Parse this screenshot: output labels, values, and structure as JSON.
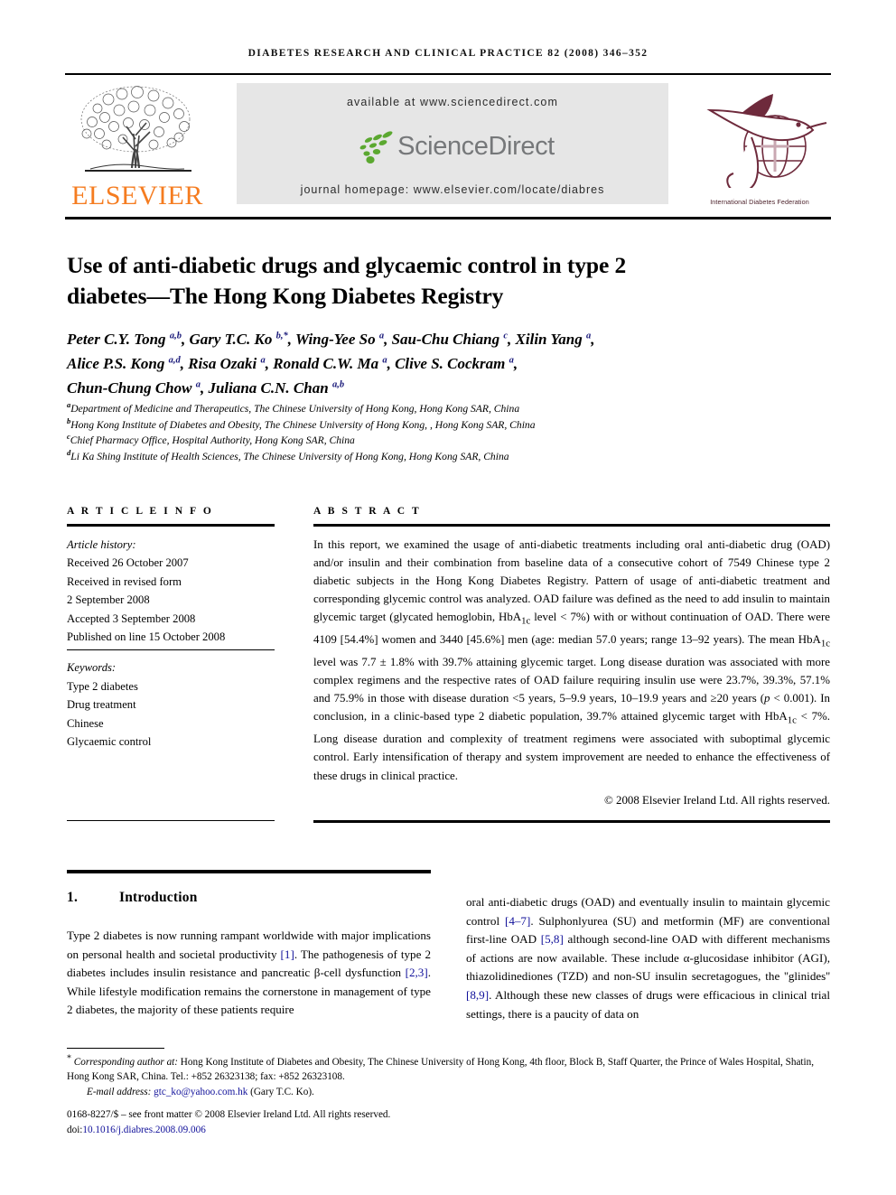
{
  "running_head": "DIABETES RESEARCH AND CLINICAL PRACTICE 82 (2008) 346–352",
  "masthead": {
    "publisher_name": "ELSEVIER",
    "available_at": "available at www.sciencedirect.com",
    "sciencedirect_word": "ScienceDirect",
    "journal_homepage": "journal homepage: www.elsevier.com/locate/diabres",
    "society_caption": "International Diabetes Federation",
    "elsevier_orange": "#F57C20",
    "banner_bg": "#E6E6E6",
    "sciencedirect_green": "#5BA830",
    "sciencedirect_gray": "#76787A",
    "idf_maroon": "#6E2A3C"
  },
  "article": {
    "title": "Use of anti-diabetic drugs and glycaemic control in type 2 diabetes—The Hong Kong Diabetes Registry",
    "authors_line_1": "Peter C.Y. Tong <sup>a,b</sup>, Gary T.C. Ko <sup>b,*</sup>, Wing-Yee So <sup>a</sup>, Sau-Chu Chiang <sup>c</sup>, Xilin Yang <sup>a</sup>,",
    "authors_line_2": "Alice P.S. Kong <sup>a,d</sup>, Risa Ozaki <sup>a</sup>, Ronald C.W. Ma <sup>a</sup>, Clive S. Cockram <sup>a</sup>,",
    "authors_line_3": "Chun-Chung Chow <sup>a</sup>, Juliana C.N. Chan <sup>a,b</sup>",
    "affiliations": [
      {
        "mark": "a",
        "text": "Department of Medicine and Therapeutics, The Chinese University of Hong Kong, Hong Kong SAR, China"
      },
      {
        "mark": "b",
        "text": "Hong Kong Institute of Diabetes and Obesity, The Chinese University of Hong Kong, , Hong Kong SAR, China"
      },
      {
        "mark": "c",
        "text": "Chief Pharmacy Office, Hospital Authority, Hong Kong SAR, China"
      },
      {
        "mark": "d",
        "text": "Li Ka Shing Institute of Health Sciences, The Chinese University of Hong Kong, Hong Kong SAR, China"
      }
    ]
  },
  "article_info": {
    "heading": "A R T I C L E   I N F O",
    "history_label": "Article history:",
    "history": [
      "Received 26 October 2007",
      "Received in revised form",
      "2 September 2008",
      "Accepted 3 September 2008",
      "Published on line 15 October 2008"
    ],
    "keywords_label": "Keywords:",
    "keywords": [
      "Type 2 diabetes",
      "Drug treatment",
      "Chinese",
      "Glycaemic control"
    ]
  },
  "abstract": {
    "heading": "A B S T R A C T",
    "text": "In this report, we examined the usage of anti-diabetic treatments including oral anti-diabetic drug (OAD) and/or insulin and their combination from baseline data of a consecutive cohort of 7549 Chinese type 2 diabetic subjects in the Hong Kong Diabetes Registry. Pattern of usage of anti-diabetic treatment and corresponding glycemic control was analyzed. OAD failure was defined as the need to add insulin to maintain glycemic target (glycated hemoglobin, HbA<sub>1c</sub> level &lt; 7%) with or without continuation of OAD. There were 4109 [54.4%] women and 3440 [45.6%] men (age: median 57.0 years; range 13–92 years). The mean HbA<sub>1c</sub> level was 7.7 ± 1.8% with 39.7% attaining glycemic target. Long disease duration was associated with more complex regimens and the respective rates of OAD failure requiring insulin use were 23.7%, 39.3%, 57.1% and 75.9% in those with disease duration &lt;5 years, 5–9.9 years, 10–19.9 years and ≥20 years (<i>p</i> &lt; 0.001). In conclusion, in a clinic-based type 2 diabetic population, 39.7% attained glycemic target with HbA<sub>1c</sub> &lt; 7%. Long disease duration and complexity of treatment regimens were associated with suboptimal glycemic control. Early intensification of therapy and system improvement are needed to enhance the effectiveness of these drugs in clinical practice.",
    "copyright": "© 2008 Elsevier Ireland Ltd. All rights reserved."
  },
  "body": {
    "section_number": "1.",
    "section_title": "Introduction",
    "left_column": "Type 2 diabetes is now running rampant worldwide with major implications on personal health and societal productivity <span class=\"cite\">[1]</span>. The pathogenesis of type 2 diabetes includes insulin resistance and pancreatic β-cell dysfunction <span class=\"cite\">[2,3]</span>. While lifestyle modification remains the cornerstone in management of type 2 diabetes, the majority of these patients require",
    "right_column": "oral anti-diabetic drugs (OAD) and eventually insulin to maintain glycemic control <span class=\"cite\">[4–7]</span>. Sulphonlyurea (SU) and metformin (MF) are conventional first-line OAD <span class=\"cite\">[5,8]</span> although second-line OAD with different mechanisms of actions are now available. These include α-glucosidase inhibitor (AGI), thiazolidinediones (TZD) and non-SU insulin secretagogues, the ''glinides'' <span class=\"cite\">[8,9]</span>. Although these new classes of drugs were efficacious in clinical trial settings, there is a paucity of data on"
  },
  "footer": {
    "corresponding_note": "<span class=\"fn-star\">*</span> <span class=\"ital\">Corresponding author at:</span> Hong Kong Institute of Diabetes and Obesity, The Chinese University of Hong Kong, 4th floor, Block B, Staff Quarter, the Prince of Wales Hospital, Shatin, Hong Kong SAR, China. Tel.: +852 26323138; fax: +852 26323108.",
    "email_label": "E-mail address:",
    "email": "gtc_ko@yahoo.com.hk",
    "email_owner": "(Gary T.C. Ko).",
    "front_matter": "0168-8227/$ – see front matter © 2008 Elsevier Ireland Ltd. All rights reserved.",
    "doi_label": "doi:",
    "doi": "10.1016/j.diabres.2008.09.006"
  }
}
